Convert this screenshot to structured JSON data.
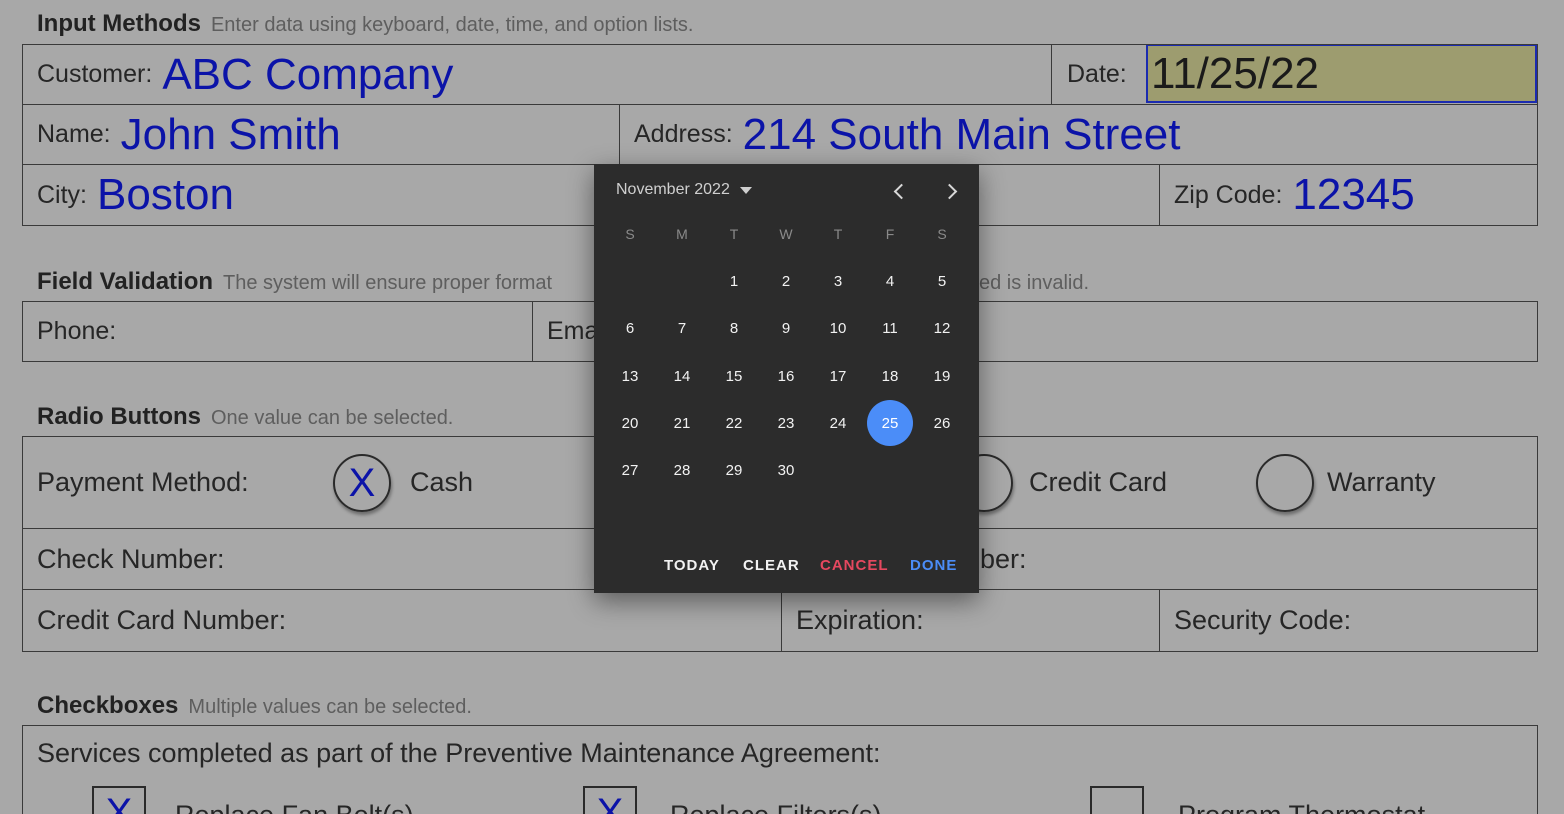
{
  "sections": {
    "input_methods": {
      "title": "Input Methods",
      "subtitle": "Enter data using keyboard, date, time, and option lists."
    },
    "field_validation": {
      "title": "Field Validation",
      "subtitle_left": "The system will ensure proper format",
      "subtitle_right": "ed is invalid."
    },
    "radio_buttons": {
      "title": "Radio Buttons",
      "subtitle": "One value can be selected."
    },
    "checkboxes": {
      "title": "Checkboxes",
      "subtitle": "Multiple values can be selected."
    }
  },
  "fields": {
    "customer": {
      "label": "Customer:",
      "value": "ABC Company"
    },
    "date": {
      "label": "Date:",
      "value": "11/25/22"
    },
    "name": {
      "label": "Name:",
      "value": "John Smith"
    },
    "address": {
      "label": "Address:",
      "value": "214 South Main Street"
    },
    "city": {
      "label": "City:",
      "value": "Boston"
    },
    "zip": {
      "label": "Zip Code:",
      "value": "12345"
    },
    "phone": {
      "label": "Phone:"
    },
    "email": {
      "label": "Ema"
    },
    "check_number": {
      "label": "Check Number:"
    },
    "right_number": {
      "label": "ber:"
    },
    "credit_card_number": {
      "label": "Credit Card Number:"
    },
    "expiration": {
      "label": "Expiration:"
    },
    "security_code": {
      "label": "Security Code:"
    }
  },
  "payment": {
    "label": "Payment Method:",
    "options": [
      {
        "label": "Cash",
        "mark": "X"
      },
      {
        "label": "Credit Card",
        "mark": ""
      },
      {
        "label": "Warranty",
        "mark": ""
      }
    ]
  },
  "services": {
    "label": "Services completed as part of the Preventive Maintenance Agreement:",
    "items": [
      {
        "label": "Replace Fan Belt(s)",
        "mark": "X"
      },
      {
        "label": "Replace Filters(s)",
        "mark": "X"
      },
      {
        "label": "Program Thermostat",
        "mark": ""
      }
    ]
  },
  "datepicker": {
    "month_label": "November 2022",
    "weekdays": [
      "S",
      "M",
      "T",
      "W",
      "T",
      "F",
      "S"
    ],
    "first_weekday": 2,
    "days_in_month": 30,
    "selected_day": 25,
    "actions": {
      "today": "TODAY",
      "clear": "CLEAR",
      "cancel": "CANCEL",
      "done": "DONE"
    },
    "colors": {
      "background": "#2c2c2c",
      "selected": "#4b8df8",
      "cancel": "#e5485f",
      "done": "#4b8df8"
    }
  },
  "colors": {
    "value_text": "#0b13a8",
    "date_highlight": "#9d9c6f",
    "page_bg": "#a8a8a8"
  }
}
